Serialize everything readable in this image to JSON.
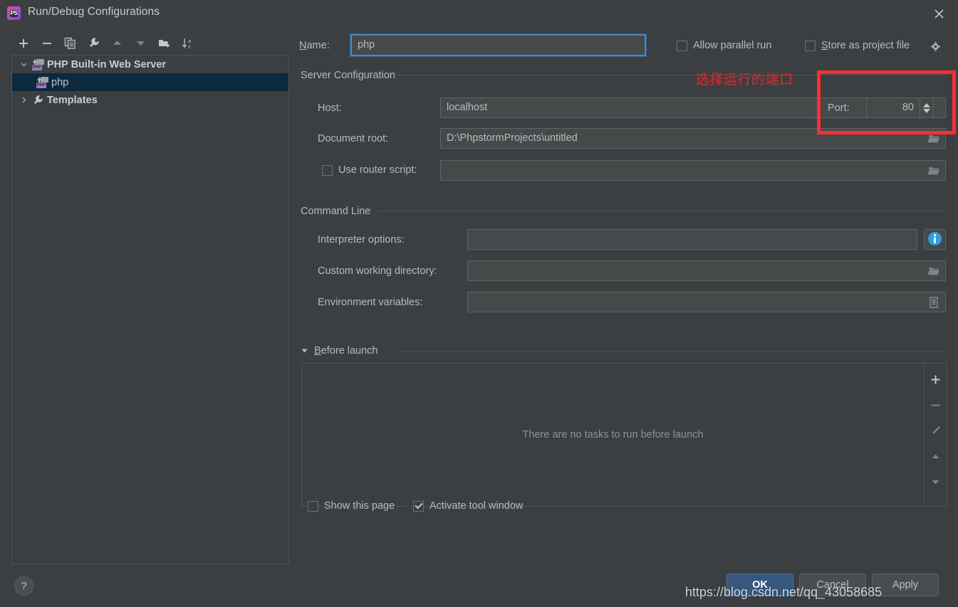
{
  "window": {
    "title": "Run/Debug Configurations",
    "app_icon": "phpstorm-icon",
    "close_label": "✕"
  },
  "toolbar": {
    "buttons": [
      {
        "name": "add-configuration-button",
        "icon": "plus-icon",
        "tooltip": "Add New Configuration"
      },
      {
        "name": "remove-configuration-button",
        "icon": "minus-icon",
        "tooltip": "Remove Configuration"
      },
      {
        "name": "copy-configuration-button",
        "icon": "copy-icon",
        "tooltip": "Copy Configuration"
      },
      {
        "name": "edit-templates-button",
        "icon": "wrench-icon",
        "tooltip": "Edit Templates"
      },
      {
        "name": "move-up-button",
        "icon": "arrow-up-icon",
        "tooltip": "Move Up"
      },
      {
        "name": "move-down-button",
        "icon": "arrow-down-icon",
        "tooltip": "Move Down"
      },
      {
        "name": "new-folder-button",
        "icon": "folder-add-icon",
        "tooltip": "Create New Folder"
      },
      {
        "name": "sort-button",
        "icon": "sort-alpha-icon",
        "tooltip": "Sort Configurations"
      }
    ]
  },
  "tree": {
    "items": [
      {
        "label": "PHP Built-in Web Server",
        "icon": "php-server-icon",
        "expanded": true,
        "selected": false,
        "level": 0
      },
      {
        "label": "php",
        "icon": "php-server-icon",
        "expanded": null,
        "selected": true,
        "level": 1
      },
      {
        "label": "Templates",
        "icon": "wrench-icon",
        "expanded": false,
        "selected": false,
        "level": 0
      }
    ]
  },
  "form": {
    "name_label": "Name:",
    "name_value": "php",
    "allow_parallel_run": {
      "label": "Allow parallel run",
      "checked": false
    },
    "store_as_project_file": {
      "label": "Store as project file",
      "checked": false
    },
    "gear_icon": "gear-icon",
    "server_configuration": {
      "title": "Server Configuration",
      "host_label": "Host:",
      "host_value": "localhost",
      "port_label": "Port:",
      "port_value": "80",
      "document_root_label": "Document root:",
      "document_root_value": "D:\\PhpstormProjects\\untitled",
      "use_router_script_label": "Use router script:",
      "use_router_script_checked": false,
      "router_script_value": ""
    },
    "command_line": {
      "title": "Command Line",
      "interpreter_options_label": "Interpreter options:",
      "interpreter_options_value": "",
      "custom_working_directory_label": "Custom working directory:",
      "custom_working_directory_value": "",
      "environment_variables_label": "Environment variables:",
      "environment_variables_value": ""
    },
    "before_launch": {
      "title": "Before launch",
      "empty_message": "There are no tasks to run before launch",
      "side_buttons": [
        {
          "name": "before-launch-add-button",
          "icon": "plus-icon"
        },
        {
          "name": "before-launch-remove-button",
          "icon": "minus-icon"
        },
        {
          "name": "before-launch-edit-button",
          "icon": "pencil-icon"
        },
        {
          "name": "before-launch-move-up-button",
          "icon": "arrow-up-icon"
        },
        {
          "name": "before-launch-move-down-button",
          "icon": "arrow-down-icon"
        }
      ],
      "show_this_page": {
        "label": "Show this page",
        "checked": false
      },
      "activate_tool_window": {
        "label": "Activate tool window",
        "checked": true
      }
    }
  },
  "footer": {
    "help_label": "?",
    "ok_label": "OK",
    "cancel_label": "Cancel",
    "apply_label": "Apply"
  },
  "annotation": {
    "text": "选择运行的端口",
    "color": "#fc2d33"
  },
  "watermark": {
    "text": "https://blog.csdn.net/qq_43058685"
  }
}
